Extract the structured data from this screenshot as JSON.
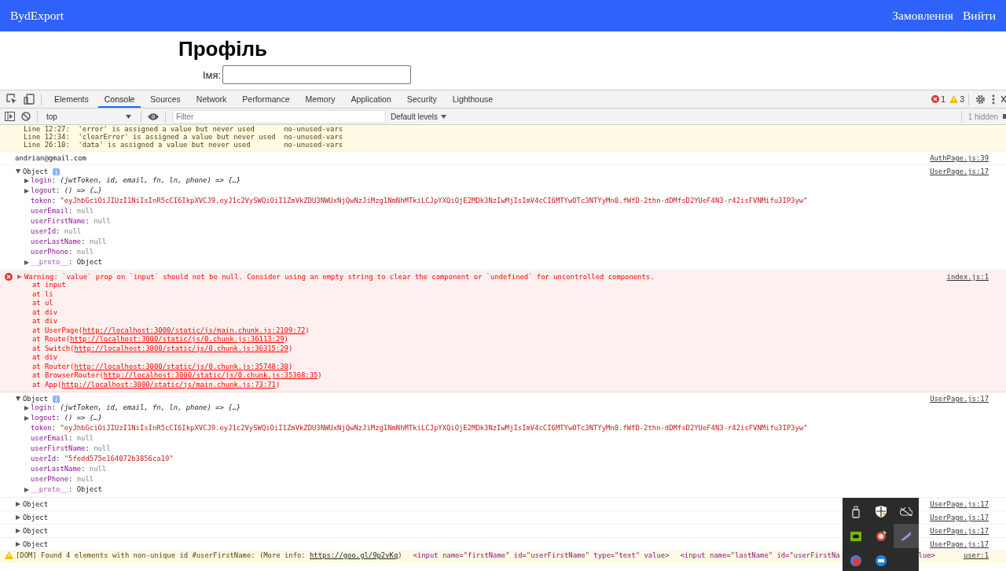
{
  "header": {
    "brand": "BydExport",
    "nav": [
      {
        "label": "Замовлення"
      },
      {
        "label": "Вийти"
      }
    ]
  },
  "page": {
    "title": "Профіль",
    "field_label": "Імя:"
  },
  "devtools": {
    "tabs": [
      {
        "label": "Elements",
        "selected": false
      },
      {
        "label": "Console",
        "selected": true
      },
      {
        "label": "Sources",
        "selected": false
      },
      {
        "label": "Network",
        "selected": false
      },
      {
        "label": "Performance",
        "selected": false
      },
      {
        "label": "Memory",
        "selected": false
      },
      {
        "label": "Application",
        "selected": false
      },
      {
        "label": "Security",
        "selected": false
      },
      {
        "label": "Lighthouse",
        "selected": false
      }
    ],
    "error_count": "1",
    "warning_count": "3",
    "context": "top",
    "filter_placeholder": "Filter",
    "levels": "Default levels",
    "hidden": "1 hidden"
  },
  "console": [
    {
      "kind": "lint",
      "lines": [
        "Line 12:27:  'error' is assigned a value but never used       no-unused-vars",
        "Line 12:34:  'clearError' is assigned a value but never used  no-unused-vars",
        "Line 26:10:  'data' is assigned a value but never used        no-unused-vars"
      ]
    },
    {
      "kind": "log",
      "text": "andrian@gmail.com",
      "source": "AuthPage.js:39"
    },
    {
      "kind": "object",
      "label": "Object",
      "expanded": true,
      "source": "UserPage.js:17",
      "separator": ":",
      "properties": [
        {
          "kind": "function",
          "key": "login",
          "value": "(jwtToken, id, email, fn, ln, phone) => {…}"
        },
        {
          "kind": "function",
          "key": "logout",
          "value": "() => {…}"
        },
        {
          "kind": "string",
          "key": "token",
          "value": "\"eyJhbGciOiJIUzI1NiIsInR5cCI6IkpXVCJ9.eyJ1c2VySWQiOiI1ZmVkZDU3NWUxNjQwNzJiMzg1NmNhMTkiLCJpYXQiOjE2MDk3NzIwMjIsImV4cCI6MTYwOTc3NTYyMn0.fWfD-2thn-dDMfsD2YUeF4N3-r42isFVNMifu3IP3yw\""
        },
        {
          "kind": "null",
          "key": "userEmail",
          "value": "null"
        },
        {
          "kind": "null",
          "key": "userFirstName",
          "value": "null"
        },
        {
          "kind": "null",
          "key": "userId",
          "value": "null"
        },
        {
          "kind": "null",
          "key": "userLastName",
          "value": "null"
        },
        {
          "kind": "null",
          "key": "userPhone",
          "value": "null"
        },
        {
          "kind": "proto",
          "key": "__proto__",
          "value": "Object"
        }
      ]
    },
    {
      "kind": "error",
      "expanded": false,
      "parens": [
        "(",
        ")"
      ],
      "message": "Warning: `value` prop on `input` should not be null. Consider using an empty string to clear the component or `undefined` for uncontrolled components.",
      "source": "index.js:1",
      "stack": [
        {
          "text": "at input"
        },
        {
          "text": "at li"
        },
        {
          "text": "at ul"
        },
        {
          "text": "at div"
        },
        {
          "text": "at div"
        },
        {
          "text": "at UserPage",
          "link": "http://localhost:3000/static/js/main.chunk.js:2109:72"
        },
        {
          "text": "at Route",
          "link": "http://localhost:3000/static/js/0.chunk.js:36113:29"
        },
        {
          "text": "at Switch",
          "link": "http://localhost:3000/static/js/0.chunk.js:36315:29"
        },
        {
          "text": "at div"
        },
        {
          "text": "at Router",
          "link": "http://localhost:3000/static/js/0.chunk.js:35748:30"
        },
        {
          "text": "at BrowserRouter",
          "link": "http://localhost:3000/static/js/0.chunk.js:35368:35"
        },
        {
          "text": "at App",
          "link": "http://localhost:3000/static/js/main.chunk.js:73:71"
        }
      ]
    },
    {
      "kind": "object",
      "label": "Object",
      "expanded": true,
      "source": "UserPage.js:17",
      "separator": ":",
      "properties": [
        {
          "kind": "function",
          "key": "login",
          "value": "(jwtToken, id, email, fn, ln, phone) => {…}"
        },
        {
          "kind": "function",
          "key": "logout",
          "value": "() => {…}"
        },
        {
          "kind": "string",
          "key": "token",
          "value": "\"eyJhbGciOiJIUzI1NiIsInR5cCI6IkpXVCJ9.eyJ1c2VySWQiOiI1ZmVkZDU3NWUxNjQwNzJiMzg1NmNhMTkiLCJpYXQiOjE2MDk3NzIwMjIsImV4cCI6MTYwOTc3NTYyMn0.fWfD-2thn-dDMfsD2YUeF4N3-r42isFVNMifu3IP3yw\""
        },
        {
          "kind": "null",
          "key": "userEmail",
          "value": "null"
        },
        {
          "kind": "null",
          "key": "userFirstName",
          "value": "null"
        },
        {
          "kind": "string",
          "key": "userId",
          "value": "\"5fedd575e164072b3856ca19\""
        },
        {
          "kind": "null",
          "key": "userLastName",
          "value": "null"
        },
        {
          "kind": "null",
          "key": "userPhone",
          "value": "null"
        },
        {
          "kind": "proto",
          "key": "__proto__",
          "value": "Object"
        }
      ]
    },
    {
      "kind": "object",
      "label": "Object",
      "expanded": false,
      "source": "UserPage.js:17"
    },
    {
      "kind": "object",
      "label": "Object",
      "expanded": false,
      "source": "UserPage.js:17"
    },
    {
      "kind": "object",
      "label": "Object",
      "expanded": false,
      "source": "UserPage.js:17"
    },
    {
      "kind": "object",
      "label": "Object",
      "expanded": false,
      "source": "UserPage.js:17"
    },
    {
      "kind": "dom",
      "text": "[DOM] Found 4 elements with non-unique id #userFirstName: (More info: ",
      "link": "https://goo.gl/9p2vKq",
      "close": ")",
      "snippets": [
        "<input name=\"firstName\" id=\"userFirstName\" type=\"text\" value>",
        "<input name=\"lastName\" id=\"userFirstNa"
      ],
      "tail": "lue>",
      "source": "user:1"
    }
  ],
  "tray": {
    "icons": [
      {
        "kind": "usb",
        "selected": false
      },
      {
        "kind": "shield",
        "selected": false
      },
      {
        "kind": "cloud",
        "selected": false
      },
      {
        "kind": "gpu",
        "selected": false
      },
      {
        "kind": "game",
        "selected": false
      },
      {
        "kind": "pen",
        "selected": true
      },
      {
        "kind": "red-app",
        "selected": false
      },
      {
        "kind": "blue-app",
        "selected": false
      }
    ]
  }
}
